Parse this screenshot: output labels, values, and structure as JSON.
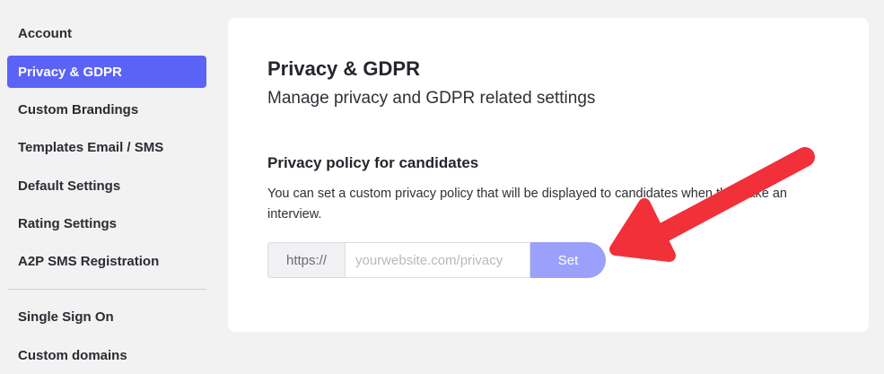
{
  "sidebar": {
    "items": [
      {
        "label": "Account",
        "active": false
      },
      {
        "label": "Privacy & GDPR",
        "active": true
      },
      {
        "label": "Custom Brandings",
        "active": false
      },
      {
        "label": "Templates Email / SMS",
        "active": false
      },
      {
        "label": "Default Settings",
        "active": false
      },
      {
        "label": "Rating Settings",
        "active": false
      },
      {
        "label": "A2P SMS Registration",
        "active": false
      },
      {
        "label": "Single Sign On",
        "active": false
      },
      {
        "label": "Custom domains",
        "active": false
      }
    ]
  },
  "main": {
    "title": "Privacy & GDPR",
    "subtitle": "Manage privacy and GDPR related settings",
    "section": {
      "title": "Privacy policy for candidates",
      "description": "You can set a custom privacy policy that will be displayed to candidates when they take an interview.",
      "url_prefix": "https://",
      "url_value": "",
      "url_placeholder": "yourwebsite.com/privacy",
      "set_label": "Set"
    }
  },
  "colors": {
    "accent": "#5b63f6",
    "set_button": "#9aa0fb",
    "arrow": "#f2303a"
  }
}
